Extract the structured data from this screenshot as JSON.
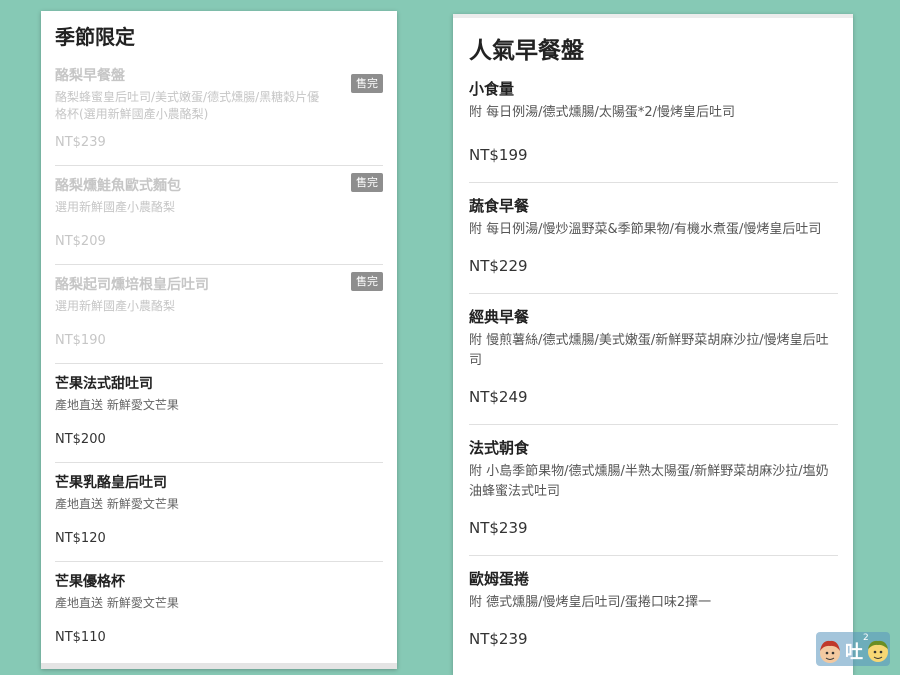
{
  "seasonal": {
    "title": "季節限定",
    "soldout_label": "售完",
    "items": [
      {
        "name": "酪梨早餐盤",
        "desc": "酪梨蜂蜜皇后吐司/美式嫩蛋/德式燻腸/黑糖穀片優格杯(選用新鮮國產小農酪梨)",
        "price": "NT$239"
      },
      {
        "name": "酪梨燻鮭魚歐式麵包",
        "desc": "選用新鮮國產小農酪梨",
        "price": "NT$209"
      },
      {
        "name": "酪梨起司燻培根皇后吐司",
        "desc": "選用新鮮國產小農酪梨",
        "price": "NT$190"
      },
      {
        "name": "芒果法式甜吐司",
        "desc": "產地直送 新鮮愛文芒果",
        "price": "NT$200"
      },
      {
        "name": "芒果乳酪皇后吐司",
        "desc": "產地直送 新鮮愛文芒果",
        "price": "NT$120"
      },
      {
        "name": "芒果優格杯",
        "desc": "產地直送 新鮮愛文芒果",
        "price": "NT$110"
      }
    ]
  },
  "popular": {
    "title": "人氣早餐盤",
    "items": [
      {
        "name": "小食量",
        "desc": "附 每日例湯/德式燻腸/太陽蛋*2/慢烤皇后吐司",
        "price": "NT$199"
      },
      {
        "name": "蔬食早餐",
        "desc": "附 每日例湯/慢炒溫野菜&季節果物/有機水煮蛋/慢烤皇后吐司",
        "price": "NT$229"
      },
      {
        "name": "經典早餐",
        "desc": "附 慢煎薯絲/德式燻腸/美式嫩蛋/新鮮野菜胡麻沙拉/慢烤皇后吐司",
        "price": "NT$249"
      },
      {
        "name": "法式朝食",
        "desc": "附 小島季節果物/德式燻腸/半熟太陽蛋/新鮮野菜胡麻沙拉/塩奶油蜂蜜法式吐司",
        "price": "NT$239"
      },
      {
        "name": "歐姆蛋捲",
        "desc": "附 德式燻腸/慢烤皇后吐司/蛋捲口味2擇一",
        "price": "NT$239"
      }
    ]
  },
  "watermark": {
    "text": "吐",
    "sup": "2"
  }
}
